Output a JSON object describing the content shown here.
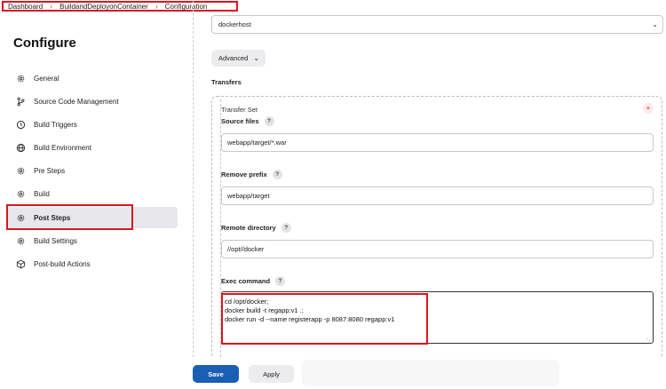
{
  "breadcrumb": {
    "items": [
      "Dashboard",
      "BuildandDeployonContainer",
      "Configuration"
    ],
    "separator": "›"
  },
  "page": {
    "title": "Configure"
  },
  "sidebar": {
    "items": [
      {
        "label": "General",
        "icon": "gear-icon"
      },
      {
        "label": "Source Code Management",
        "icon": "branch-icon"
      },
      {
        "label": "Build Triggers",
        "icon": "clock-icon"
      },
      {
        "label": "Build Environment",
        "icon": "globe-icon"
      },
      {
        "label": "Pre Steps",
        "icon": "gear-icon"
      },
      {
        "label": "Build",
        "icon": "gear-icon"
      },
      {
        "label": "Post Steps",
        "icon": "gear-icon",
        "active": true
      },
      {
        "label": "Build Settings",
        "icon": "gear-icon"
      },
      {
        "label": "Post-build Actions",
        "icon": "cube-icon"
      }
    ]
  },
  "server": {
    "selected": "dockerhost"
  },
  "advanced": {
    "label": "Advanced"
  },
  "transfers": {
    "label": "Transfers",
    "set_title": "Transfer Set",
    "close_symbol": "×",
    "source_files": {
      "label": "Source files",
      "value": "webapp/target/*.war"
    },
    "remove_prefix": {
      "label": "Remove prefix",
      "value": "webapp/target"
    },
    "remote_directory": {
      "label": "Remote directory",
      "value": "//opt//docker"
    },
    "exec_command": {
      "label": "Exec command",
      "lines": [
        "cd /opt/docker;",
        "docker build -t regapp:v1 .;",
        "docker run -d --name registerapp -p 8087:8080 regapp:v1"
      ]
    },
    "help_symbol": "?"
  },
  "actions": {
    "save": "Save",
    "apply": "Apply"
  },
  "colors": {
    "highlight": "#d7171f",
    "primary": "#1a5fb4"
  }
}
